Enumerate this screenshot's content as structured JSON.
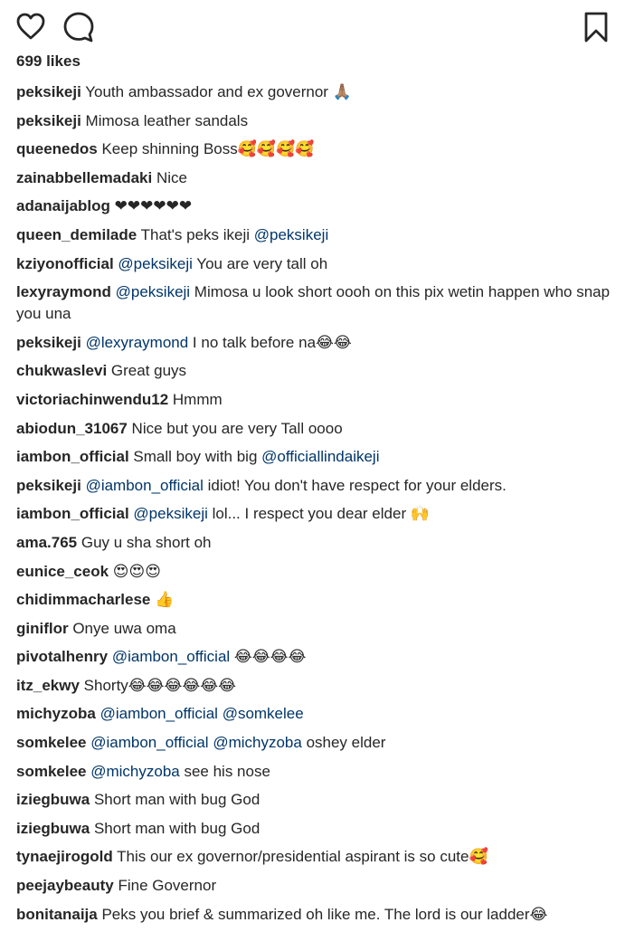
{
  "post": {
    "likes_label": "699 likes"
  },
  "icons": {
    "like": "heart-icon",
    "comment": "comment-bubble-icon",
    "save": "bookmark-icon"
  },
  "colors": {
    "text": "#262626",
    "mention": "#003569"
  },
  "comments": [
    {
      "user": "peksikeji",
      "mention": "",
      "text": " Youth ambassador and ex governor 🙏🏽"
    },
    {
      "user": "peksikeji",
      "mention": "",
      "text": " Mimosa leather sandals"
    },
    {
      "user": "queenedos",
      "mention": "",
      "text": " Keep shinning Boss🥰🥰🥰🥰"
    },
    {
      "user": "zainabbellemadaki",
      "mention": "",
      "text": " Nice"
    },
    {
      "user": "adanaijablog",
      "mention": "",
      "text": " ❤❤❤❤❤❤"
    },
    {
      "user": "queen_demilade",
      "mention": "@peksikeji",
      "text": " That's peks ikeji ",
      "mention_after": true
    },
    {
      "user": "kziyonofficial",
      "mention": "@peksikeji",
      "text": " You are very tall oh"
    },
    {
      "user": "lexyraymond",
      "mention": "@peksikeji",
      "text": " Mimosa u look short oooh on this pix wetin happen who snap you una"
    },
    {
      "user": "peksikeji",
      "mention": "@lexyraymond",
      "text": " I no talk before na😂😂"
    },
    {
      "user": "chukwaslevi",
      "mention": "",
      "text": " Great guys"
    },
    {
      "user": "victoriachinwendu12",
      "mention": "",
      "text": " Hmmm"
    },
    {
      "user": "abiodun_31067",
      "mention": "",
      "text": " Nice but you are very Tall oooo"
    },
    {
      "user": "iambon_official",
      "mention": "@officiallindaikeji",
      "text": " Small boy with big ",
      "mention_after": true
    },
    {
      "user": "peksikeji",
      "mention": "@iambon_official",
      "text": " idiot! You don't have respect for your elders."
    },
    {
      "user": "iambon_official",
      "mention": "@peksikeji",
      "text": " lol... I respect you dear elder 🙌"
    },
    {
      "user": "ama.765",
      "mention": "",
      "text": " Guy u sha short oh"
    },
    {
      "user": "eunice_ceok",
      "mention": "",
      "text": " 😍😍😍"
    },
    {
      "user": "chidimmacharlese",
      "mention": "",
      "text": " 👍"
    },
    {
      "user": "giniflor",
      "mention": "",
      "text": " Onye uwa oma"
    },
    {
      "user": "pivotalhenry",
      "mention": "@iambon_official",
      "text": " 😂😂😂😂"
    },
    {
      "user": "itz_ekwy",
      "mention": "",
      "text": " Shorty😂😂😂😂😂😂"
    },
    {
      "user": "michyzoba",
      "mention": "@iambon_official @somkelee",
      "text": ""
    },
    {
      "user": "somkelee",
      "mention": "@iambon_official @michyzoba",
      "text": " oshey elder"
    },
    {
      "user": "somkelee",
      "mention": "@michyzoba",
      "text": " see his nose"
    },
    {
      "user": "iziegbuwa",
      "mention": "",
      "text": " Short man with bug God"
    },
    {
      "user": "iziegbuwa",
      "mention": "",
      "text": " Short man with bug God"
    },
    {
      "user": "tynaejirogold",
      "mention": "",
      "text": " This our ex governor/presidential aspirant is so cute🥰"
    },
    {
      "user": "peejaybeauty",
      "mention": "",
      "text": " Fine Governor"
    },
    {
      "user": "bonitanaija",
      "mention": "",
      "text": " Peks you brief & summarized oh like me. The lord is our ladder😂"
    }
  ]
}
